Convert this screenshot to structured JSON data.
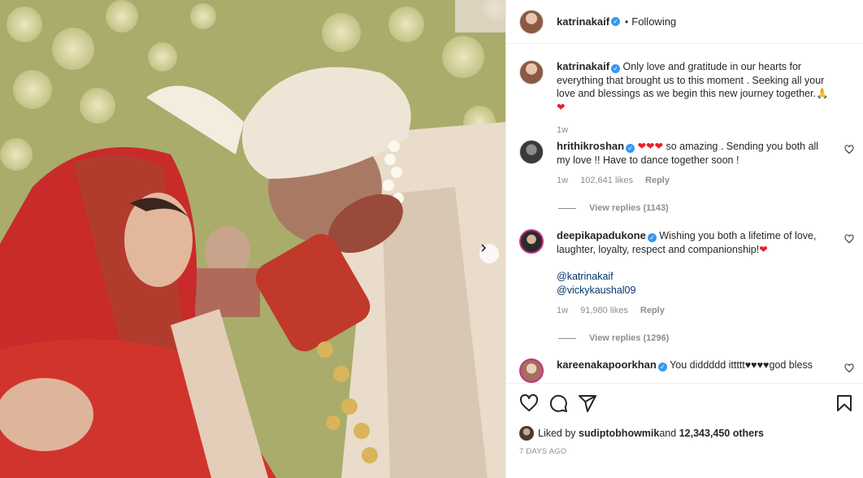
{
  "post": {
    "username": "katrinakaif",
    "follow_status": "Following",
    "caption_username": "katrinakaif",
    "caption": "Only love and gratitude in our hearts for everything that brought us to this moment . Seeking all your love and blessings as we begin this new journey together.🙏",
    "caption_heart": "❤",
    "caption_time": "1w"
  },
  "comments": [
    {
      "username": "hrithikroshan",
      "hearts": "❤❤❤",
      "text": " so amazing . Sending you both all my love !! Have to dance together soon !",
      "time": "1w",
      "likes": "102,641 likes",
      "reply_label": "Reply",
      "view_replies": "View replies (1143)"
    },
    {
      "username": "deepikapadukone",
      "text": "Wishing you both a lifetime of love, laughter, loyalty, respect and companionship!",
      "heart": "❤",
      "mention1": "@katrinakaif",
      "mention2": "@vickykaushal09",
      "time": "1w",
      "likes": "91,980 likes",
      "reply_label": "Reply",
      "view_replies": "View replies (1296)"
    },
    {
      "username": "kareenakapoorkhan",
      "text": "You diddddd ittttt♥♥♥♥god bless"
    }
  ],
  "footer": {
    "liked_by_prefix": "Liked by ",
    "liked_by_user": "sudiptobhowmik",
    "liked_by_mid": " and ",
    "liked_by_count": "12,343,450 others",
    "timestamp": "7 DAYS AGO"
  },
  "icons": {
    "like": "heart-icon",
    "comment": "comment-icon",
    "share": "share-icon",
    "save": "bookmark-icon",
    "next": "chevron-right-icon"
  },
  "colors": {
    "verified": "#3897f0",
    "heart_red": "#ed1c24",
    "link": "#00376b",
    "muted": "#8e8e8e"
  }
}
